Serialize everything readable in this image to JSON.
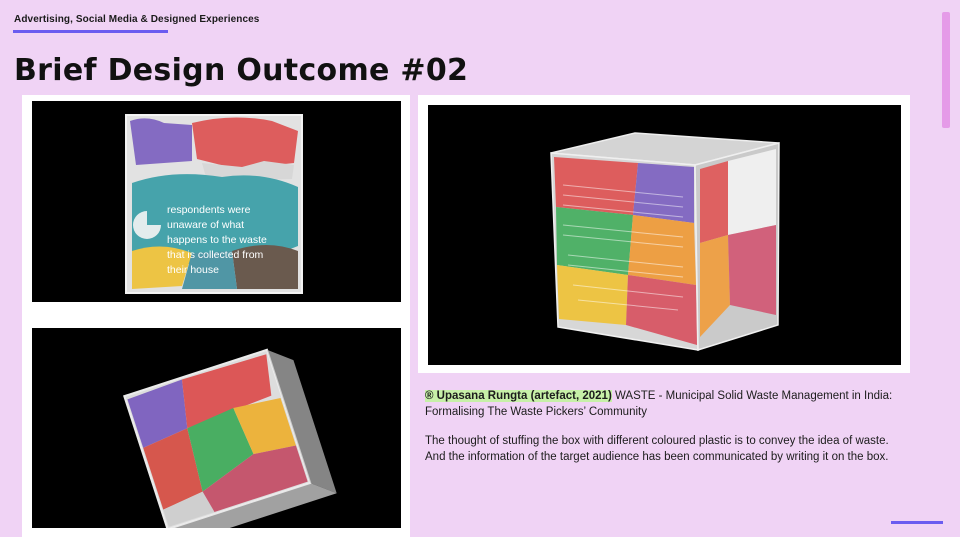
{
  "header": {
    "kicker": "Advertising, Social Media & Designed Experiences",
    "title": "Brief Design Outcome #02"
  },
  "photo_top_left": {
    "box_text": "respondents were unaware of what happens to the waste that is collected from their house"
  },
  "caption": {
    "credit": "® Upasana Rungta (artefact, 2021)",
    "project": " WASTE - Municipal Solid Waste Management in India: Formalising The Waste Pickers’ Community",
    "body": "The thought of stuffing the box with different coloured plastic is to convey the idea of waste. And the information of the target audience has been communicated by writing it on the box."
  },
  "colors": {
    "background": "#f0d3f5",
    "accent_line": "#6b5cf0",
    "scroll_indicator": "#e59be8",
    "credit_highlight": "#c7f0a8"
  }
}
